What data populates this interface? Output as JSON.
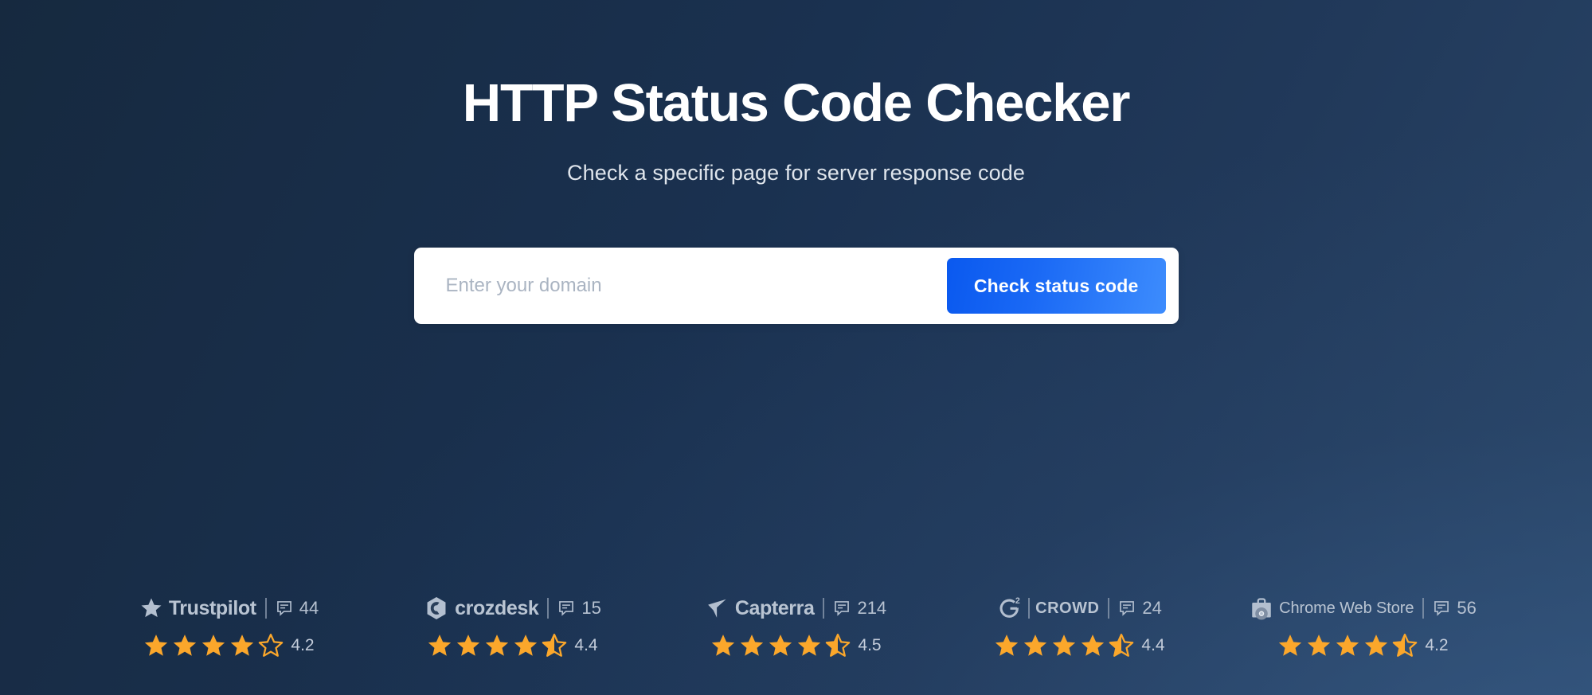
{
  "hero": {
    "title": "HTTP Status Code Checker",
    "subtitle": "Check a specific page for server response code"
  },
  "search": {
    "placeholder": "Enter your domain",
    "value": "",
    "button_label": "Check status code"
  },
  "colors": {
    "background_dark": "#16293f",
    "background_light": "#2a4668",
    "button_gradient_start": "#0a59ef",
    "button_gradient_end": "#3d8cfd",
    "star_filled": "#fba72b",
    "brand_text": "#b9c4d2"
  },
  "badges": [
    {
      "brand": "Trustpilot",
      "logo_icon": "trustpilot-star-icon",
      "review_icon": "comment-icon",
      "review_count": "44",
      "rating": "4.2",
      "stars_full": 4,
      "stars_half": 0,
      "stars_empty": 1
    },
    {
      "brand": "crozdesk",
      "logo_icon": "crozdesk-hexagon-icon",
      "review_icon": "comment-icon",
      "review_count": "15",
      "rating": "4.4",
      "stars_full": 4,
      "stars_half": 1,
      "stars_empty": 0
    },
    {
      "brand": "Capterra",
      "logo_icon": "capterra-arrow-icon",
      "review_icon": "comment-icon",
      "review_count": "214",
      "rating": "4.5",
      "stars_full": 4,
      "stars_half": 1,
      "stars_empty": 0
    },
    {
      "brand": "CROWD",
      "logo_icon": "g2-crowd-icon",
      "review_icon": "comment-icon",
      "review_count": "24",
      "rating": "4.4",
      "stars_full": 4,
      "stars_half": 1,
      "stars_empty": 0
    },
    {
      "brand": "Chrome Web Store",
      "logo_icon": "chrome-web-store-bag-icon",
      "review_icon": "comment-icon",
      "review_count": "56",
      "rating": "4.2",
      "stars_full": 4,
      "stars_half": 1,
      "stars_empty": 0
    }
  ]
}
